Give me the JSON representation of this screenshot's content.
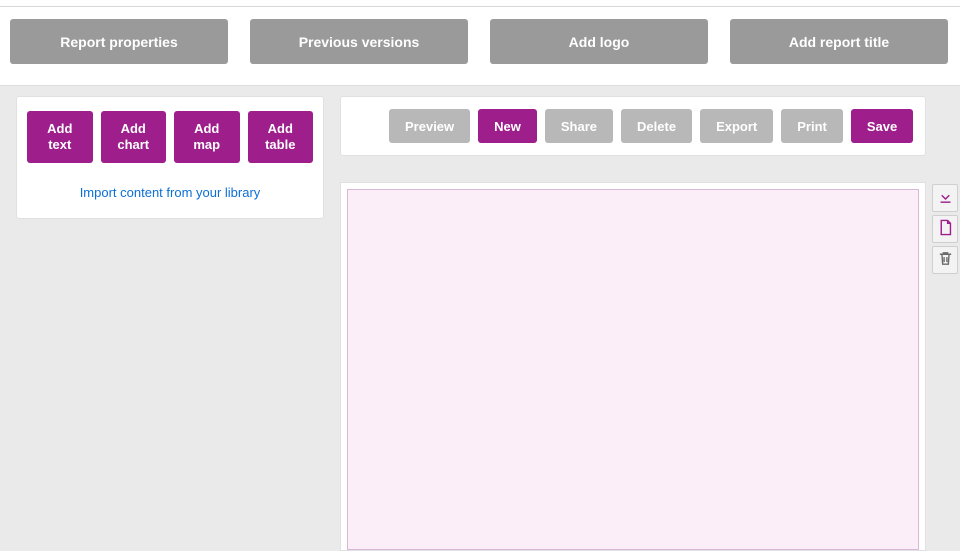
{
  "colors": {
    "primary": "#9e1e8c",
    "grey_btn": "#9a9a9a",
    "grey_action": "#b8b8b8",
    "link": "#0b6fd6",
    "canvas_fill": "#fbeef9",
    "canvas_border": "#d9b7d7"
  },
  "topbar": {
    "report_properties": "Report properties",
    "previous_versions": "Previous versions",
    "add_logo": "Add logo",
    "add_report_title": "Add report title"
  },
  "leftpanel": {
    "add_text": "Add\ntext",
    "add_chart": "Add\nchart",
    "add_map": "Add\nmap",
    "add_table": "Add\ntable",
    "import_library": "Import content from your library"
  },
  "actions": {
    "preview": "Preview",
    "new": "New",
    "share": "Share",
    "delete": "Delete",
    "export": "Export",
    "print": "Print",
    "save": "Save"
  },
  "sidetools": {
    "download": "download-icon",
    "page": "page-icon",
    "trash": "trash-icon"
  }
}
